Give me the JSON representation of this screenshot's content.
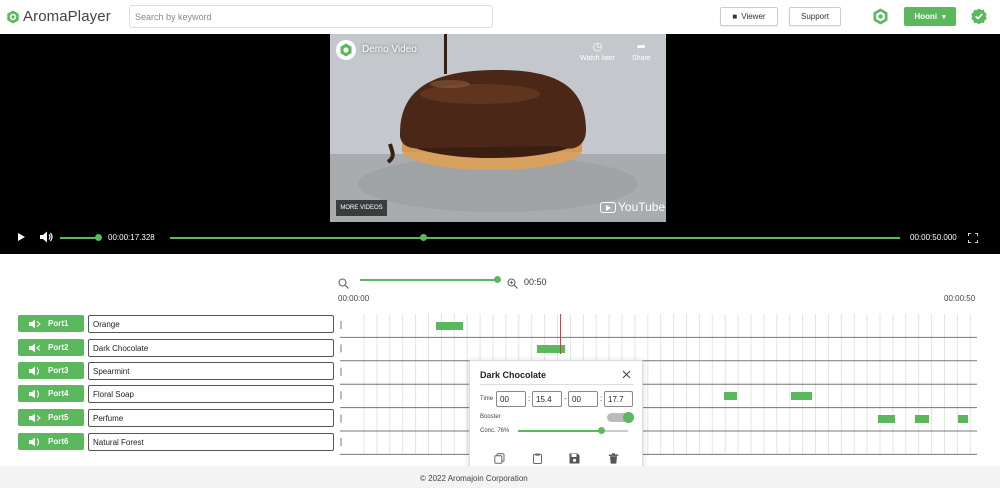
{
  "app": {
    "name": "AromaPlayer"
  },
  "header": {
    "search_placeholder": "Search by keyword",
    "viewer_label": "Viewer",
    "support_label": "Support",
    "user_label": "Hooni",
    "accent_color": "#5cb85c"
  },
  "video": {
    "title": "Demo Video",
    "watch_later_label": "Watch later",
    "share_label": "Share",
    "more_videos_label": "MORE VIDEOS",
    "youtube_label": "YouTube",
    "current_time": "00:00:17.328",
    "end_time": "00:00:50.000",
    "progress": 0.34,
    "volume": 0.9
  },
  "timeline": {
    "zoom_value": "00:50",
    "start_label": "00:00:00",
    "end_label": "00:00:50"
  },
  "ports": [
    {
      "label": "Port1",
      "name": "Orange"
    },
    {
      "label": "Port2",
      "name": "Dark Chocolate"
    },
    {
      "label": "Port3",
      "name": "Spearmint"
    },
    {
      "label": "Port4",
      "name": "Floral Soap"
    },
    {
      "label": "Port5",
      "name": "Perfume"
    },
    {
      "label": "Port6",
      "name": "Natural Forest"
    }
  ],
  "popup": {
    "title": "Dark Chocolate",
    "time_label": "Time",
    "start_min": "00",
    "start_sec": "15.4",
    "end_min": "00",
    "end_sec": "17.7",
    "booster_label": "Booster",
    "booster_on": true,
    "conc_label": "Conc. 76%",
    "conc_value": 0.76
  },
  "footer": {
    "text": "© 2022 Aromajoin Corporation"
  }
}
